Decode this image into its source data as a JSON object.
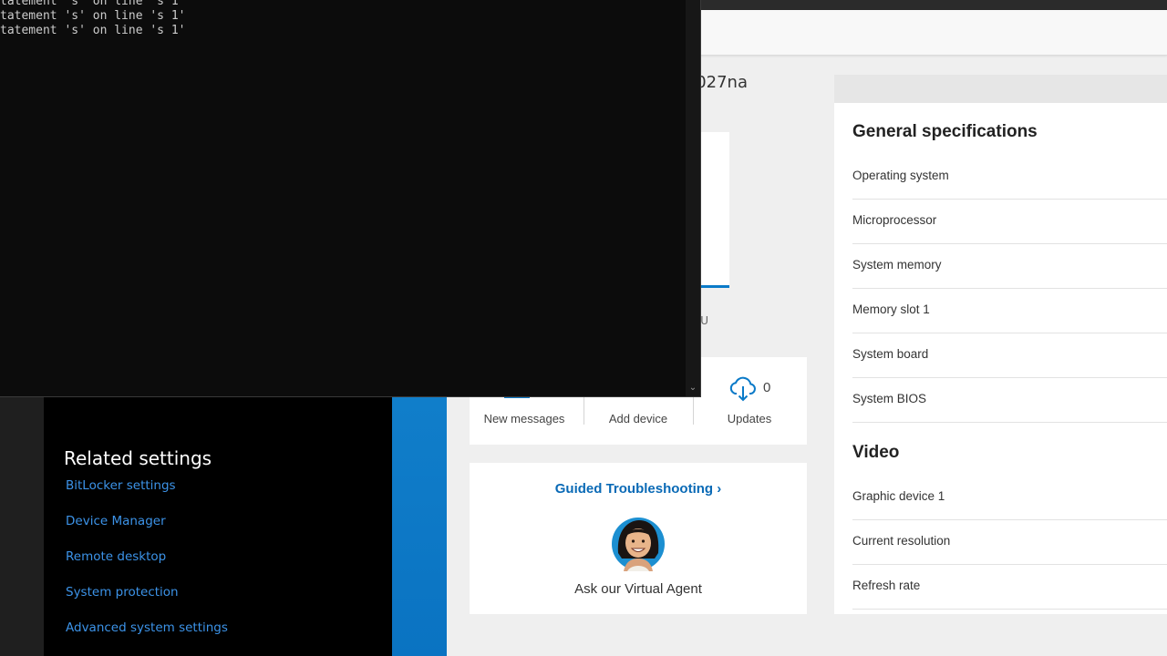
{
  "console": {
    "lines": [
      "",
      "tatement 's' on line 's 1'",
      "tatement 's' on line 's 1'",
      "tatement 's' on line 's 1'"
    ]
  },
  "hp": {
    "product_title": "027na",
    "product_sku": "U",
    "tiles": {
      "messages_label": "New messages",
      "add_device_label": "Add device",
      "updates_label": "Updates",
      "updates_count": "0"
    },
    "guided": {
      "link": "Guided Troubleshooting ›",
      "agent_label": "Ask our Virtual Agent"
    },
    "specs": {
      "general_heading": "General specifications",
      "general_rows": [
        "Operating system",
        "Microprocessor",
        "System memory",
        "Memory slot 1",
        "System board",
        "System BIOS"
      ],
      "video_heading": "Video",
      "video_rows": [
        "Graphic device 1",
        "Current resolution",
        "Refresh rate"
      ]
    }
  },
  "settings": {
    "related_heading": "Related settings",
    "links": [
      "BitLocker settings",
      "Device Manager",
      "Remote desktop",
      "System protection",
      "Advanced system settings"
    ]
  },
  "colors": {
    "accent_blue": "#0a7ac8",
    "link_blue": "#3c93e8",
    "console_bg": "#0c0c0c"
  }
}
